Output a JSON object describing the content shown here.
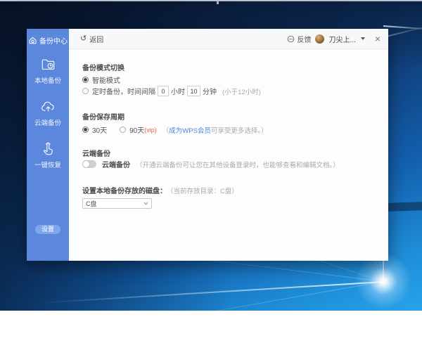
{
  "sidebar": {
    "logo_label": "备份中心",
    "items": [
      {
        "label": "本地备份"
      },
      {
        "label": "云端备份"
      },
      {
        "label": "一键恢复"
      }
    ],
    "settings_label": "设置"
  },
  "header": {
    "back_icon": "↺",
    "back_label": "返回",
    "feedback_label": "反馈",
    "username": "刀尖上...",
    "close_glyph": "×"
  },
  "content": {
    "mode": {
      "title": "备份模式切换",
      "smart_label": "智能模式",
      "timed_prefix": "定时备份，时间间隔",
      "hours_value": "0",
      "hours_unit": "小时",
      "minutes_value": "10",
      "minutes_unit": "分钟",
      "limit_note": "(小于12小时)"
    },
    "period": {
      "title": "备份保存周期",
      "days30_label": "30天",
      "days90_label": "90天",
      "vip_tag": "(vip)",
      "paren_open": "（ ",
      "member_link": "成为WPS会员",
      "note_rest": " 可享受更多选择。）"
    },
    "cloud": {
      "title": "云端备份",
      "toggle_label": "云端备份",
      "note": "（开通云端备份可让您在其他设备登录时，也能够查看和编辑文档。）"
    },
    "disk": {
      "title": "设置本地备份存放的磁盘：",
      "current_note": "（当前存放目录：C盘）",
      "selected_disk": "C盘"
    }
  },
  "colors": {
    "sidebar_blue": "#5b88dc",
    "link_blue": "#4a86d8",
    "vip_orange": "#e8643c"
  }
}
